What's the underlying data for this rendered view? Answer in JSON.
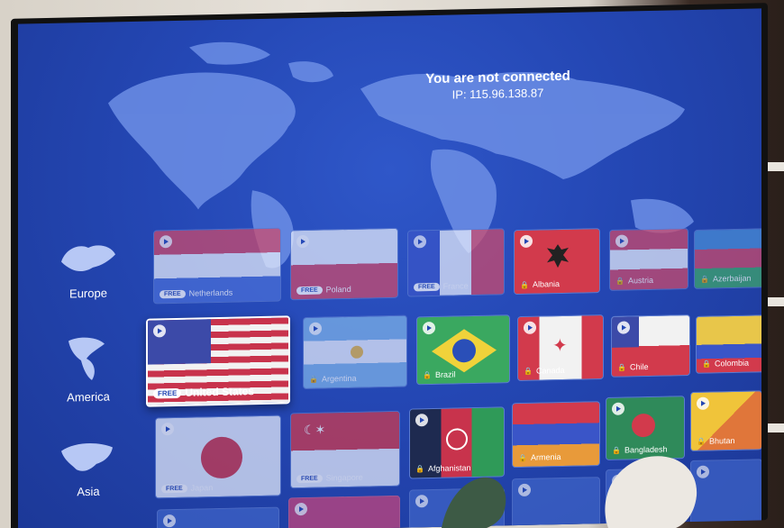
{
  "status": {
    "title": "You are not connected",
    "ip": "IP: 115.96.138.87"
  },
  "regions": [
    {
      "label": "Europe"
    },
    {
      "label": "America"
    },
    {
      "label": "Asia"
    }
  ],
  "free_label": "FREE",
  "servers": [
    {
      "name": "Netherlands",
      "free": true
    },
    {
      "name": "Poland",
      "free": true
    },
    {
      "name": "France",
      "free": true
    },
    {
      "name": "Albania",
      "free": false
    },
    {
      "name": "Austria",
      "free": false
    },
    {
      "name": "Azerbaijan",
      "free": false
    },
    {
      "name": "United States",
      "free": true
    },
    {
      "name": "Argentina",
      "free": false
    },
    {
      "name": "Brazil",
      "free": false
    },
    {
      "name": "Canada",
      "free": false
    },
    {
      "name": "Chile",
      "free": false
    },
    {
      "name": "Colombia",
      "free": false
    },
    {
      "name": "Japan",
      "free": true
    },
    {
      "name": "Singapore",
      "free": true
    },
    {
      "name": "Afghanistan",
      "free": false
    },
    {
      "name": "Armenia",
      "free": false
    },
    {
      "name": "Bangladesh",
      "free": false
    },
    {
      "name": "Bhutan",
      "free": false
    }
  ],
  "colors": {
    "screen": "#2447b4",
    "accent": "#ffffff"
  }
}
